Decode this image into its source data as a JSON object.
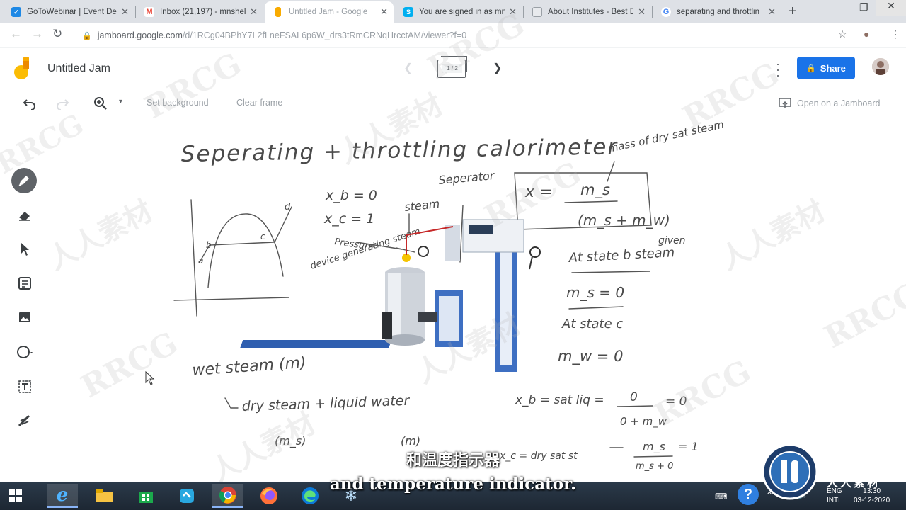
{
  "browser": {
    "tabs": [
      {
        "title": "GoToWebinar | Event De",
        "icon": "gotowebinar-icon",
        "color": "#1e88e5",
        "active": false
      },
      {
        "title": "Inbox (21,197) - mnshela",
        "icon": "gmail-icon",
        "color": "#ea4335",
        "active": false
      },
      {
        "title": "Untitled Jam - Google",
        "icon": "jamboard-icon",
        "color": "#f9ab00",
        "active": true
      },
      {
        "title": "You are signed in as mn",
        "icon": "skype-icon",
        "color": "#00aff0",
        "active": false
      },
      {
        "title": "About Institutes - Best E",
        "icon": "page-icon",
        "color": "#9aa0a6",
        "active": false
      },
      {
        "title": "separating and throttlin",
        "icon": "google-icon",
        "color": "#4285f4",
        "active": false
      }
    ],
    "url_domain": "jamboard.google.com",
    "url_path": "/d/1RCg04BPhY7L2fLneFSAL6p6W_drs3tRmCRNqHrcctAM/viewer?f=0"
  },
  "app": {
    "title": "Untitled Jam",
    "frame_counter": "1 / 2",
    "share_label": "Share",
    "toolbar": {
      "set_background": "Set background",
      "clear_frame": "Clear frame",
      "open_on_jamboard": "Open on a Jamboard"
    },
    "tools": [
      "pen-icon",
      "eraser-icon",
      "select-icon",
      "sticky-note-icon",
      "image-icon",
      "circle-icon",
      "text-box-icon",
      "laser-icon"
    ]
  },
  "canvas": {
    "heading": "Seperating + throttling calorimeter",
    "mass_note": "mass of dry sat steam",
    "separator_label": "Seperator",
    "xb": "x_b = 0",
    "xc": "x_c = 1",
    "steam_label": "steam",
    "pressure_label": "Pressure",
    "device_label": "device generating steam",
    "x_eq_lhs": "x =",
    "x_numerator": "m_s",
    "x_denominator": "(m_s + m_w)",
    "given": "given",
    "state_b": "At state b steam",
    "ms_zero": "m_s = 0",
    "state_c": "At state c",
    "mw_zero": "m_w = 0",
    "wet_steam": "wet steam (m)",
    "dry_steam": "dry steam + liquid water",
    "ms_paren": "(m_s)",
    "m_paren": "(m)",
    "xb_sat": "x_b = sat liq =",
    "frac_top": "0",
    "frac_bottom": "0 + m_w",
    "eq_zero": "= 0",
    "xc_dry": "x_c = dry sat st",
    "frac2_top": "m_s",
    "frac2_bottom": "m_s + 0",
    "eq_one": "= 1",
    "graph_points": [
      "a",
      "b",
      "c",
      "d"
    ]
  },
  "subtitles": {
    "chinese": "和温度指示器",
    "english": "and temperature indicator."
  },
  "watermark": {
    "latin": "RRCG",
    "chinese": "人人素材"
  },
  "taskbar": {
    "apps": [
      "start-icon",
      "ie-icon",
      "file-explorer-icon",
      "store-icon",
      "skype-icon",
      "chrome-icon",
      "firefox-icon",
      "edge-icon",
      "snowflake-icon"
    ],
    "lang_top": "ENG",
    "lang_bottom": "INTL",
    "time": "13:30",
    "date": "03-12-2020"
  }
}
